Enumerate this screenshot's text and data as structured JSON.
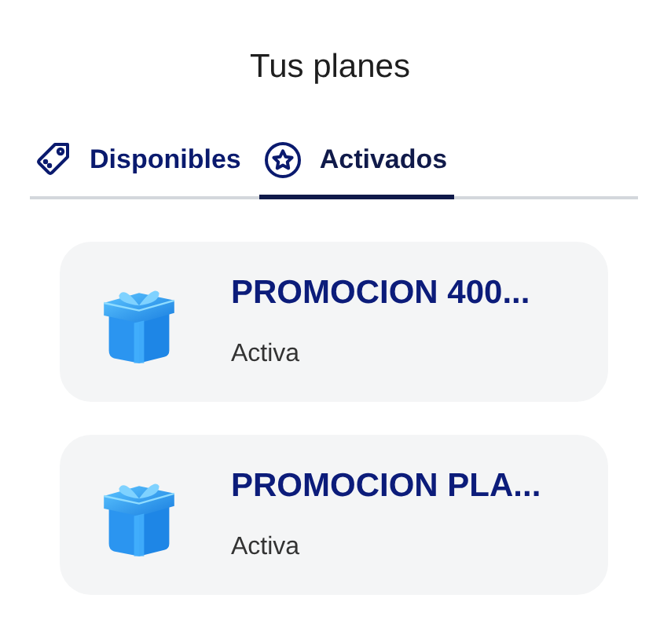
{
  "header": {
    "title": "Tus planes"
  },
  "tabs": [
    {
      "label": "Disponibles",
      "kind": "tag",
      "selected": false
    },
    {
      "label": "Activados",
      "kind": "star",
      "selected": true
    }
  ],
  "plans": [
    {
      "title": "PROMOCION 400...",
      "status": "Activa"
    },
    {
      "title": "PROMOCION PLA...",
      "status": "Activa"
    }
  ]
}
